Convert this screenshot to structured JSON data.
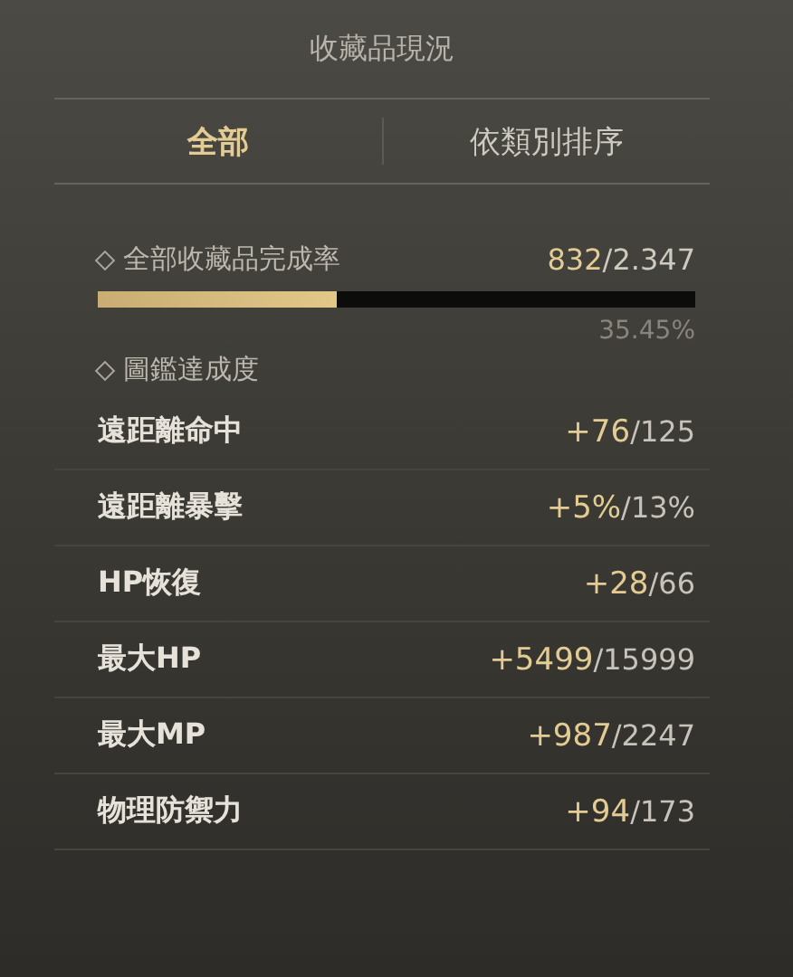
{
  "title": "收藏品現況",
  "tabs": [
    {
      "label": "全部",
      "selected": true
    },
    {
      "label": "依類別排序",
      "selected": false
    }
  ],
  "completion": {
    "label": "全部收藏品完成率",
    "count": "832",
    "total": "/2.347",
    "level": 0.4,
    "percent": "35.45%"
  },
  "codex": {
    "label": "圖鑑達成度",
    "rows": [
      {
        "name": "遠距離命中",
        "bonus": "+76",
        "max": "/125"
      },
      {
        "name": "遠距離暴擊",
        "bonus": "+5%",
        "max": "/13%"
      },
      {
        "name": "HP恢復",
        "bonus": "+28",
        "max": "/66"
      },
      {
        "name": "最大HP",
        "bonus": "+5499",
        "max": "/15999"
      },
      {
        "name": "最大MP",
        "bonus": "+987",
        "max": "/2247"
      },
      {
        "name": "物理防禦力",
        "bonus": "+94",
        "max": "/173"
      }
    ]
  }
}
